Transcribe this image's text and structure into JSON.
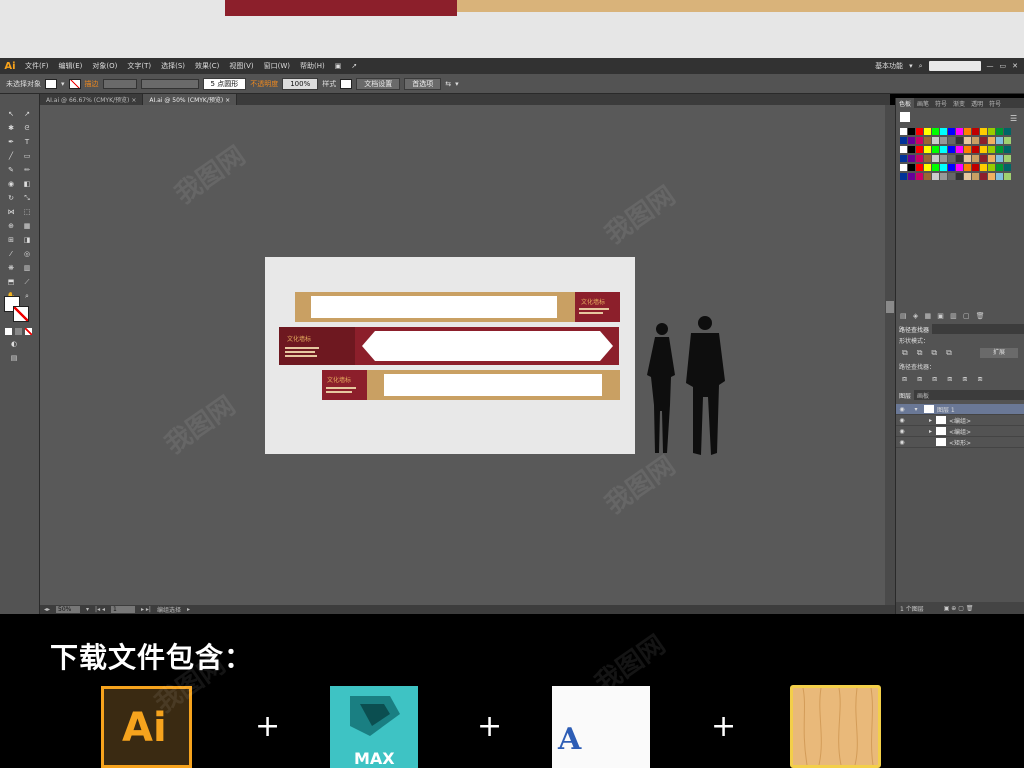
{
  "colors": {
    "app_bg": "#535353",
    "canvas": "#595959",
    "accent_orange": "#f08a1f",
    "maroon": "#8c1f2b",
    "gold": "#c9a063"
  },
  "menubar": {
    "logo": "Ai",
    "items": [
      "文件(F)",
      "编辑(E)",
      "对象(O)",
      "文字(T)",
      "选择(S)",
      "效果(C)",
      "视图(V)",
      "窗口(W)",
      "帮助(H)"
    ],
    "workspace": "基本功能"
  },
  "controlbar": {
    "selection_label": "未选择对象",
    "stroke_label": "描边",
    "point_value": "5 点圆形",
    "opacity_label": "不透明度",
    "opacity_value": "100%",
    "style_label": "样式",
    "doc_setup_button": "文档设置",
    "preferences_button": "首选项"
  },
  "tabs": [
    {
      "label": "AI.ai @ 66.67% (CMYK/预览)",
      "close": "×",
      "active": false
    },
    {
      "label": "AI.ai @ 50% (CMYK/预览)",
      "close": "×",
      "active": true
    }
  ],
  "statusbar": {
    "zoom": "50%",
    "page": "1",
    "status_text": "编组选择"
  },
  "panels": {
    "swatch_tabs": [
      "色板",
      "画笔",
      "符号",
      "渐变",
      "透明",
      "符号"
    ],
    "pathfinder_tabs": [
      "路径查找器"
    ],
    "shape_modes_label": "形状模式：",
    "expand_button": "扩展",
    "pathfinder_label": "路径查找器：",
    "layers_tabs": [
      "图层",
      "画板"
    ],
    "layers": [
      {
        "name": "图层 1",
        "level": 0
      },
      {
        "name": "<编组>",
        "level": 1
      },
      {
        "name": "<编组>",
        "level": 1
      },
      {
        "name": "<矩形>",
        "level": 1
      }
    ],
    "layers_count": "1 个图层"
  },
  "swatch_colors": [
    "#ffffff",
    "#000000",
    "#ff0000",
    "#ffff00",
    "#00ff00",
    "#00ffff",
    "#0000ff",
    "#ff00ff",
    "#ff8000",
    "#c00000",
    "#ffcc00",
    "#99cc00",
    "#009933",
    "#006666",
    "#003399",
    "#660099",
    "#cc0066",
    "#996633",
    "#cccccc",
    "#999999",
    "#666666",
    "#333333",
    "#e6c8a0",
    "#c9a063",
    "#8c1f2b",
    "#f0b060",
    "#80c0e0",
    "#a0d070"
  ],
  "design": {
    "label_small": "文化墙标"
  },
  "promo": {
    "title": "下载文件包含：",
    "ai_label": "Ai",
    "max_label": "MAX",
    "font_label": "A",
    "plus": "+"
  },
  "watermark": "我图网"
}
